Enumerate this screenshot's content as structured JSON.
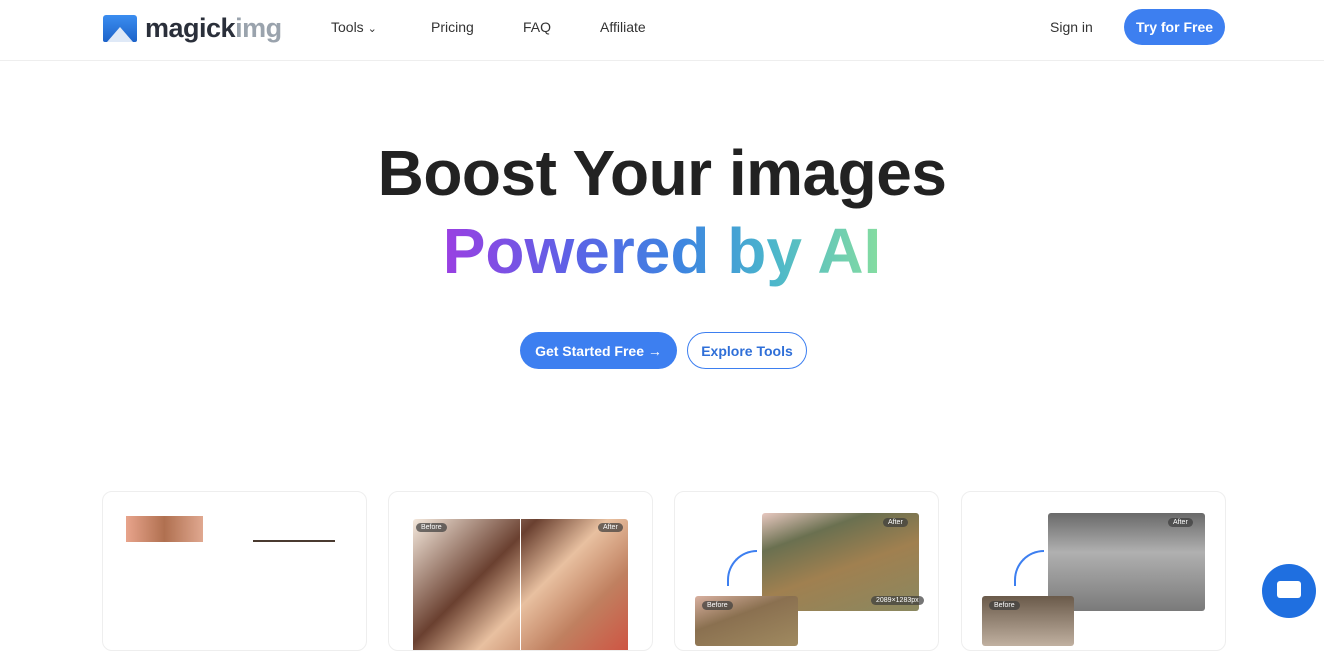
{
  "nav": {
    "logo_main": "magick",
    "logo_accent": "img",
    "tools": "Tools",
    "tools_chevron": "⌄",
    "pricing": "Pricing",
    "faq": "FAQ",
    "affiliate": "Affiliate",
    "sign_in": "Sign in",
    "try_free": "Try for Free"
  },
  "hero": {
    "line1": "Boost Your images",
    "line2": "Powered by AI",
    "gradient_colors": [
      "#9a3fe2",
      "#3d86e0",
      "#86dda0"
    ],
    "cta_primary": "Get Started Free →",
    "cta_secondary": "Explore Tools"
  },
  "cards": {
    "before": "Before",
    "after": "After",
    "resolution": "2089×1283px"
  },
  "accent": "#3d7ff0"
}
